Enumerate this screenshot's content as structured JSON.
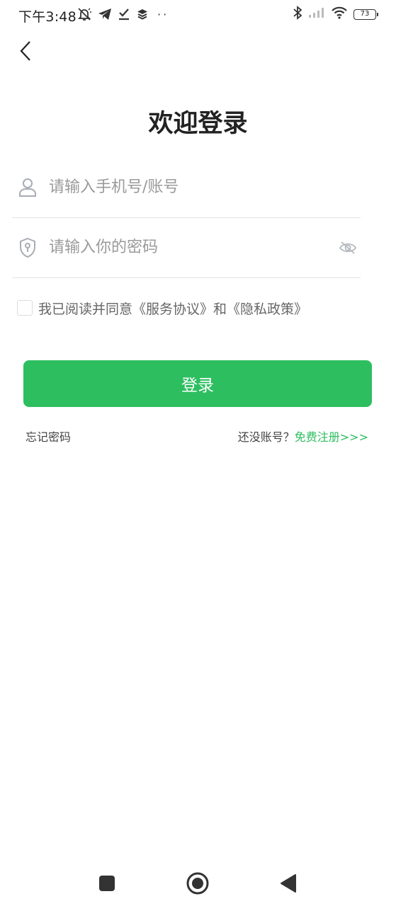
{
  "status_bar": {
    "time": "下午3:48",
    "battery": "73",
    "left_icons": [
      "notifications-muted-icon",
      "telegram-icon",
      "checklist-icon",
      "layers-icon"
    ],
    "more_dots": "··",
    "right_icons": [
      "bluetooth-icon",
      "signal-icon",
      "wifi-icon",
      "battery-icon"
    ]
  },
  "header": {
    "back_icon": "chevron-left-icon",
    "title": "欢迎登录"
  },
  "form": {
    "phone_placeholder": "请输入手机号/账号",
    "phone_value": "",
    "password_placeholder": "请输入你的密码",
    "password_value": "",
    "phone_icon": "user-icon",
    "password_icon": "shield-lock-icon",
    "visibility_icon": "eye-off-icon"
  },
  "agreement": {
    "checked": false,
    "prefix": "我已阅读并同意",
    "service_link": "《服务协议》",
    "connector": "和",
    "privacy_link": "《隐私政策》"
  },
  "actions": {
    "login_label": "登录",
    "forgot_password": "忘记密码",
    "register_prompt": "还没账号？",
    "register_link": "免费注册>>>"
  },
  "colors": {
    "accent": "#2dbe60",
    "divider": "#e2e2e2",
    "placeholder": "#9a9a9a"
  },
  "nav_bar": {
    "icons": [
      "recents-square-icon",
      "home-circle-icon",
      "back-triangle-icon"
    ]
  }
}
